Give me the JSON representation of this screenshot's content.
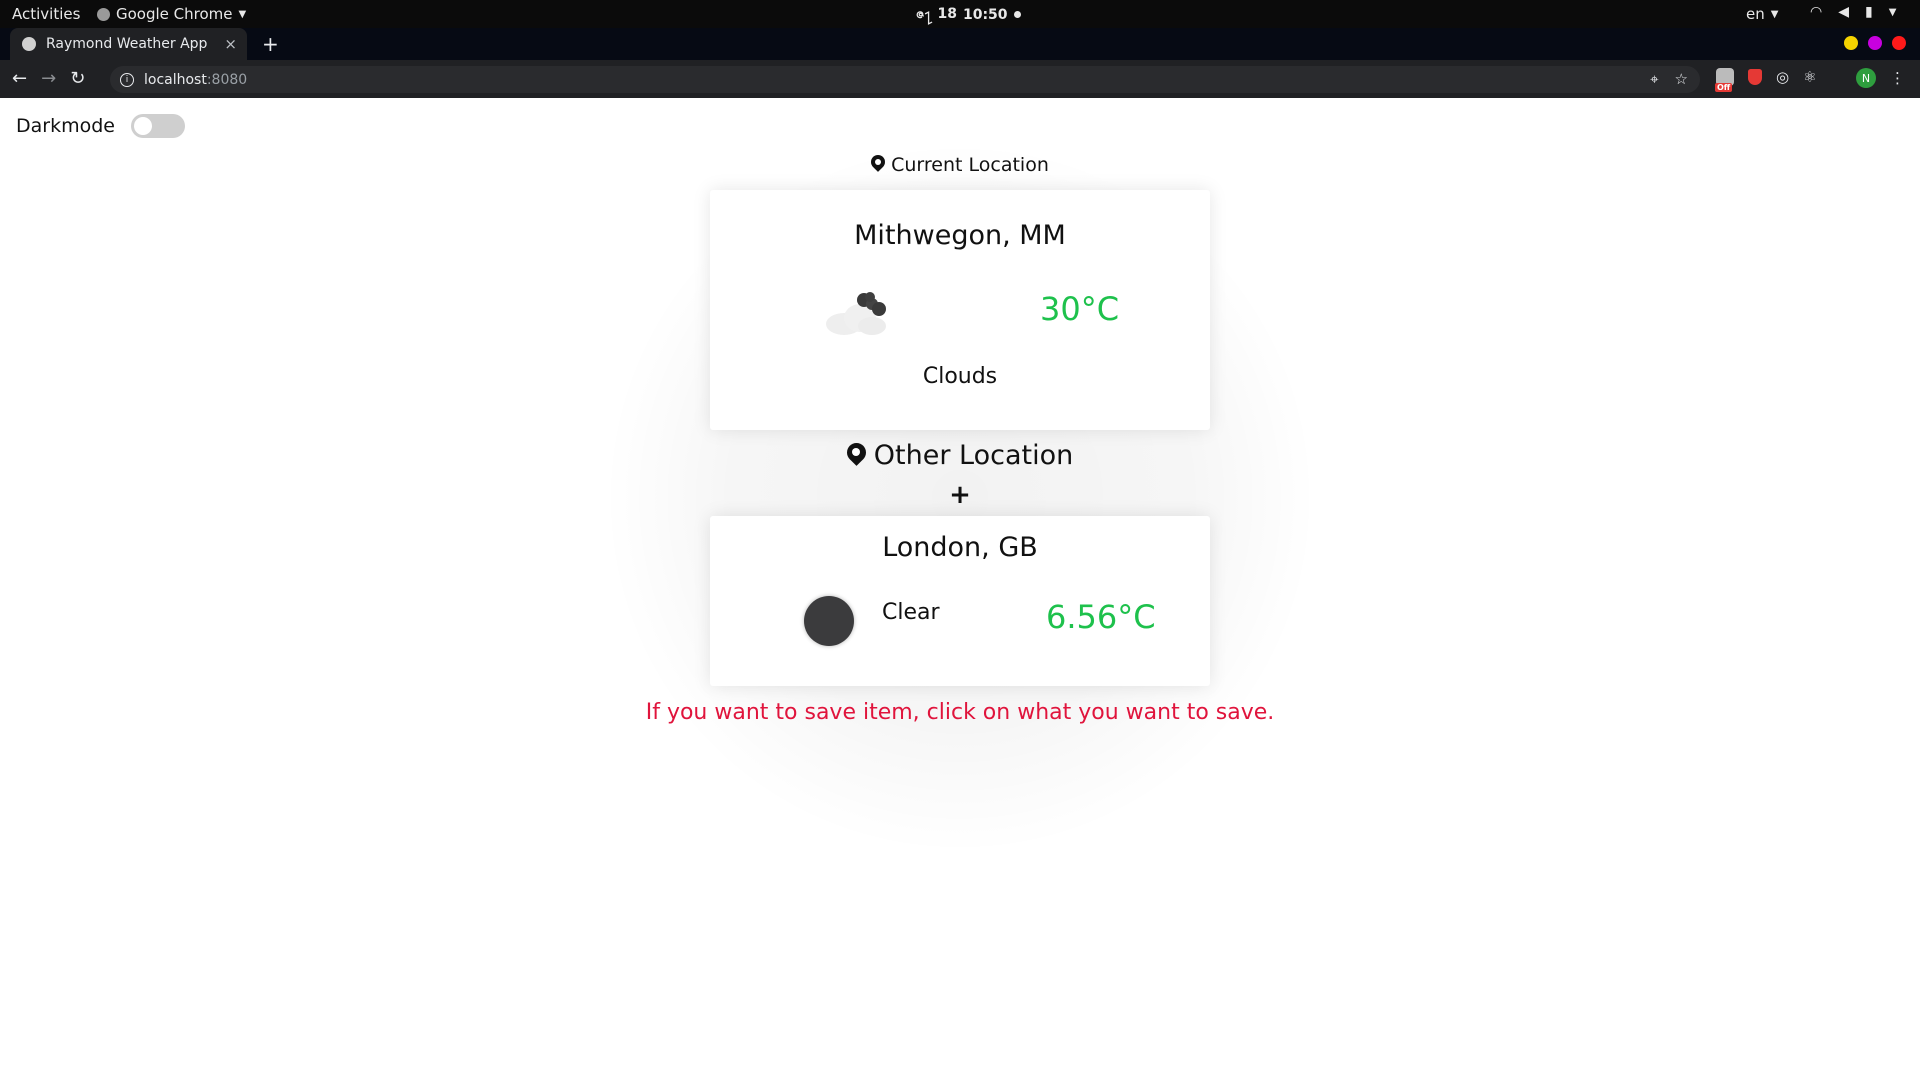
{
  "system_bar": {
    "activities": "Activities",
    "app_name": "Google Chrome",
    "date": "ဇ႑ 18",
    "time": "10:50",
    "language": "en"
  },
  "browser": {
    "tab_title": "Raymond Weather App",
    "tab_close": "×",
    "new_tab": "+",
    "url_host": "localhost",
    "url_port": ":8080",
    "profile_initial": "N",
    "extension_badge": "Off",
    "window_controls": {
      "minimize": "#f5d300",
      "maximize": "#c800e0",
      "close": "#ff1a1a"
    }
  },
  "page": {
    "darkmode_label": "Darkmode",
    "darkmode_enabled": false,
    "current_location": {
      "heading": "Current Location",
      "city": "Mithwegon, MM",
      "temperature": "30°C",
      "condition": "Clouds",
      "icon": "clouds-icon"
    },
    "other_location": {
      "heading": "Other Location",
      "add_label": "+",
      "city": "London, GB",
      "condition": "Clear",
      "temperature": "6.56°C",
      "icon": "clear-night-icon"
    },
    "hint": "If you want to save item, click on what you want to save.",
    "colors": {
      "temperature": "#1ec14c",
      "hint": "#e0143c"
    }
  }
}
